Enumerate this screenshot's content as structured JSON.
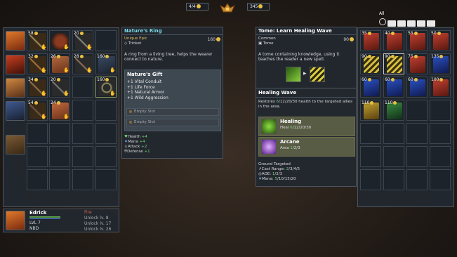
{
  "topbar": {
    "party_count": "4/4",
    "gold": "345"
  },
  "left_inventory": {
    "rows": [
      {
        "slots": [
          "58",
          "",
          "20",
          ""
        ]
      },
      {
        "slots": [
          "32",
          "26",
          "28",
          "160"
        ]
      },
      {
        "slots": [
          "34",
          "20",
          "",
          "160"
        ]
      },
      {
        "slots": [
          "54",
          "24",
          "",
          ""
        ]
      }
    ]
  },
  "character": {
    "name": "Edrick",
    "level": "LVL 7",
    "class": "NBD",
    "school": "Fire",
    "unlock1": "Unlock lv. 8",
    "unlock2": "Unlock lv. 17",
    "unlock3": "Unlock lv. 26"
  },
  "item_tooltip": {
    "title": "Nature's Ring",
    "rarity": "Unique Epic",
    "type": "Trinket",
    "price": "160",
    "description": "A ring from a living tree, helps the wearer connect to nature.",
    "gift_title": "Nature's Gift",
    "gift_lines": [
      "+1 Vital Conduit",
      "+1 Life Force",
      "+1 Natural Armor",
      "+1 Wild Aggression"
    ],
    "empty_slot_1": "Empty Slot",
    "empty_slot_2": "Empty Slot",
    "stats": [
      {
        "label": "Health",
        "value": "+4"
      },
      {
        "label": "Mana",
        "value": "+4"
      },
      {
        "label": "Attack",
        "value": "+2"
      },
      {
        "label": "Defense",
        "value": "+1"
      }
    ]
  },
  "tome_tooltip": {
    "title": "Tome: Learn Healing Wave",
    "rarity": "Common",
    "type": "Tome",
    "price": "90",
    "description": "A tome containing knowledge, using it teaches the reader a new spell.",
    "spell_name": "Healing Wave",
    "spell_desc_pre": "Restores ",
    "spell_desc_val": "6",
    "spell_desc_post": "/12/20/30 health to the targeted allies in the area.",
    "healing_label": "Healing",
    "healing_pre": "Heal ",
    "healing_val": "6",
    "healing_post": "/12/20/30",
    "arcane_label": "Arcane",
    "arcane_pre": "Area ",
    "arcane_val": "1",
    "arcane_post": "/2/3",
    "ground_targeted": "Ground Targeted",
    "cast_range_pre": "Cast Range: ",
    "cast_range_val": "2",
    "cast_range_post": "/3/4/5",
    "aoe_pre": "AOE: ",
    "aoe_val": "1",
    "aoe_post": "/2/3",
    "mana_pre": "Mana: ",
    "mana_val": "5",
    "mana_post": "/10/15/20"
  },
  "right_store": {
    "filter_label": "All",
    "items": [
      "35",
      "40",
      "55",
      "50",
      "90",
      "90",
      "75",
      "135",
      "60",
      "60",
      "60",
      "100",
      "110",
      "110"
    ]
  },
  "colors": {
    "accent_gold": "#e8c040",
    "heal_green": "#6cd070",
    "title_cyan": "#7ad8e6"
  }
}
